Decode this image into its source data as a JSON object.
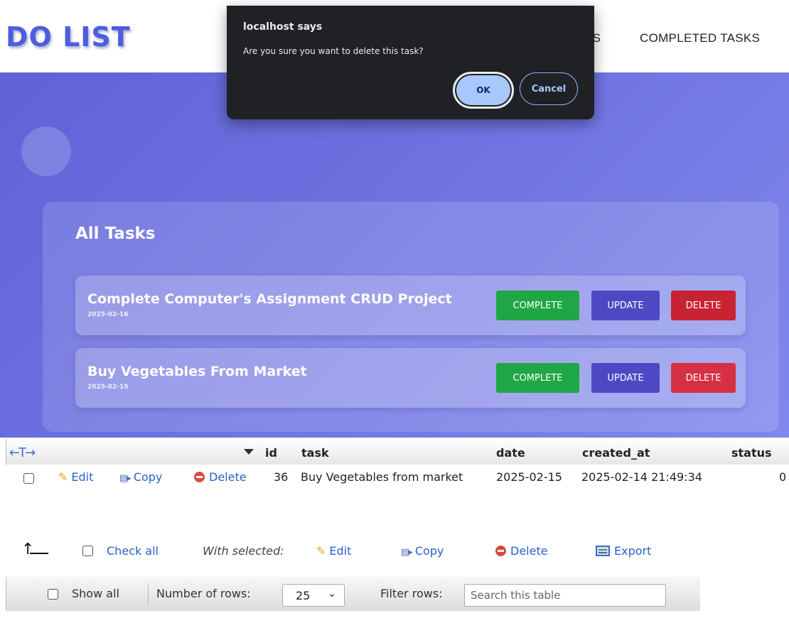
{
  "app": {
    "logo": "DO LIST",
    "nav_partial": "KS",
    "nav_completed": "COMPLETED TASKS",
    "panel_title": "All Tasks",
    "tasks": [
      {
        "title": "Complete Computer's Assignment CRUD Project",
        "date": "2025-02-16"
      },
      {
        "title": "Buy Vegetables From Market",
        "date": "2025-02-15"
      }
    ],
    "btn_complete": "COMPLETE",
    "btn_update": "UPDATE",
    "btn_delete": "DELETE"
  },
  "dialog": {
    "title": "localhost says",
    "message": "Are you sure you want to delete this task?",
    "ok": "OK",
    "cancel": "Cancel"
  },
  "pma": {
    "columns": [
      "id",
      "task",
      "date",
      "created_at",
      "status"
    ],
    "row": {
      "edit": "Edit",
      "copy": "Copy",
      "delete": "Delete",
      "id": "36",
      "task": "Buy Vegetables from market",
      "date": "2025-02-15",
      "created_at": "2025-02-14 21:49:34",
      "status": "0"
    },
    "bulk": {
      "check_all": "Check all",
      "with_selected": "With selected:",
      "edit": "Edit",
      "copy": "Copy",
      "delete": "Delete",
      "export": "Export"
    },
    "nav": {
      "show_all": "Show all",
      "rows_label": "Number of rows:",
      "rows_value": "25",
      "filter_label": "Filter rows:",
      "search_placeholder": "Search this table"
    }
  }
}
